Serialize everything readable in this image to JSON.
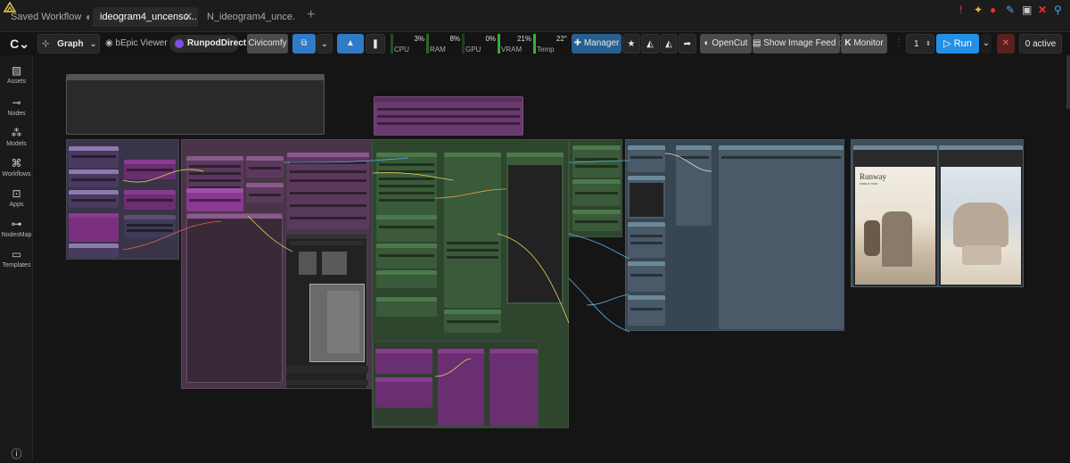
{
  "tabs": [
    {
      "label": "Saved Workflow",
      "modified": true
    },
    {
      "label": "ideogram4_uncenso...",
      "active": true
    },
    {
      "label": "N_ideogram4_unce..."
    }
  ],
  "toolbar": {
    "mode_label": "Graph",
    "viewer_label": "bEpic Viewer",
    "runpod_label": "RunpodDirect",
    "civicomfy_label": "Civicomfy",
    "manager_label": "Manager",
    "opencut_label": "OpenCut",
    "imagefeed_label": "Show Image Feed",
    "monitor_label": "Monitor",
    "queue_count": "1",
    "run_label": "Run",
    "active_label": "0 active"
  },
  "monitors": [
    {
      "label": "CPU",
      "value": "3%",
      "level": 0.03,
      "color": "#35c435"
    },
    {
      "label": "RAM",
      "value": "8%",
      "level": 0.08,
      "color": "#35c435"
    },
    {
      "label": "GPU",
      "value": "0%",
      "level": 0.0,
      "color": "#35c435"
    },
    {
      "label": "VRAM",
      "value": "21%",
      "level": 0.21,
      "color": "#35c435"
    },
    {
      "label": "Temp",
      "value": "22°",
      "level": 0.22,
      "color": "#35c435"
    }
  ],
  "sidebar": [
    {
      "label": "Assets",
      "icon": "image-icon"
    },
    {
      "label": "Nodes",
      "icon": "nodes-icon"
    },
    {
      "label": "Models",
      "icon": "models-icon"
    },
    {
      "label": "Workflows",
      "icon": "workflow-icon"
    },
    {
      "label": "Apps",
      "icon": "apps-icon"
    },
    {
      "label": "NodesMap",
      "icon": "sitemap-icon"
    },
    {
      "label": "Templates",
      "icon": "templates-icon"
    }
  ],
  "help_icon": "help-icon",
  "preview": {
    "brand": "Runway",
    "sub": "WORLD TOUR"
  },
  "colors": {
    "accent": "#2390e8",
    "manager": "#275f8f",
    "group_purple": "#6a3a6f",
    "group_green": "#2f4a2f",
    "group_slate": "#3d4a55"
  }
}
